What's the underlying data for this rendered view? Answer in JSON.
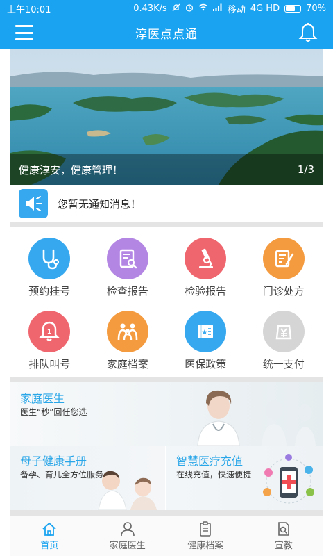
{
  "status_bar": {
    "time": "上午10:01",
    "net_speed": "0.43K/s",
    "carrier": "移动",
    "network": "4G HD",
    "battery": "70%",
    "battery_level": 0.7
  },
  "header": {
    "title": "淳医点点通",
    "menu_icon": "menu-icon",
    "bell_icon": "bell-icon"
  },
  "banner": {
    "caption": "健康淳安，健康管理！",
    "counter": "1/3"
  },
  "notice": {
    "icon": "speaker-icon",
    "text": "您暂无通知消息！"
  },
  "grid": {
    "items": [
      {
        "label": "预约挂号",
        "icon": "stethoscope-icon",
        "color": "#36a8ef"
      },
      {
        "label": "检查报告",
        "icon": "report-search-icon",
        "color": "#b486e4"
      },
      {
        "label": "检验报告",
        "icon": "microscope-icon",
        "color": "#f0666f"
      },
      {
        "label": "门诊处方",
        "icon": "prescription-icon",
        "color": "#f59b3f"
      },
      {
        "label": "排队叫号",
        "icon": "queue-bell-icon",
        "color": "#f0666f"
      },
      {
        "label": "家庭档案",
        "icon": "family-icon",
        "color": "#f59b3f"
      },
      {
        "label": "医保政策",
        "icon": "policy-book-icon",
        "color": "#36a8ef"
      },
      {
        "label": "统一支付",
        "icon": "yuan-payment-icon",
        "color": "#d5d5d5"
      }
    ]
  },
  "promos": {
    "doctor": {
      "title": "家庭医生",
      "subtitle": "医生“秒”回任您选"
    },
    "mom": {
      "title": "母子健康手册",
      "subtitle": "备孕、育儿全方位服务"
    },
    "recharge": {
      "title": "智慧医疗充值",
      "subtitle": "在线充值，快速便捷"
    }
  },
  "tabbar": {
    "tabs": [
      {
        "label": "首页",
        "icon": "home-icon",
        "active": true
      },
      {
        "label": "家庭医生",
        "icon": "doctor-person-icon",
        "active": false
      },
      {
        "label": "健康档案",
        "icon": "clipboard-icon",
        "active": false
      },
      {
        "label": "宣教",
        "icon": "doc-search-icon",
        "active": false
      }
    ]
  },
  "colors": {
    "primary": "#1aa3f0",
    "accent_text": "#29a6e8"
  }
}
